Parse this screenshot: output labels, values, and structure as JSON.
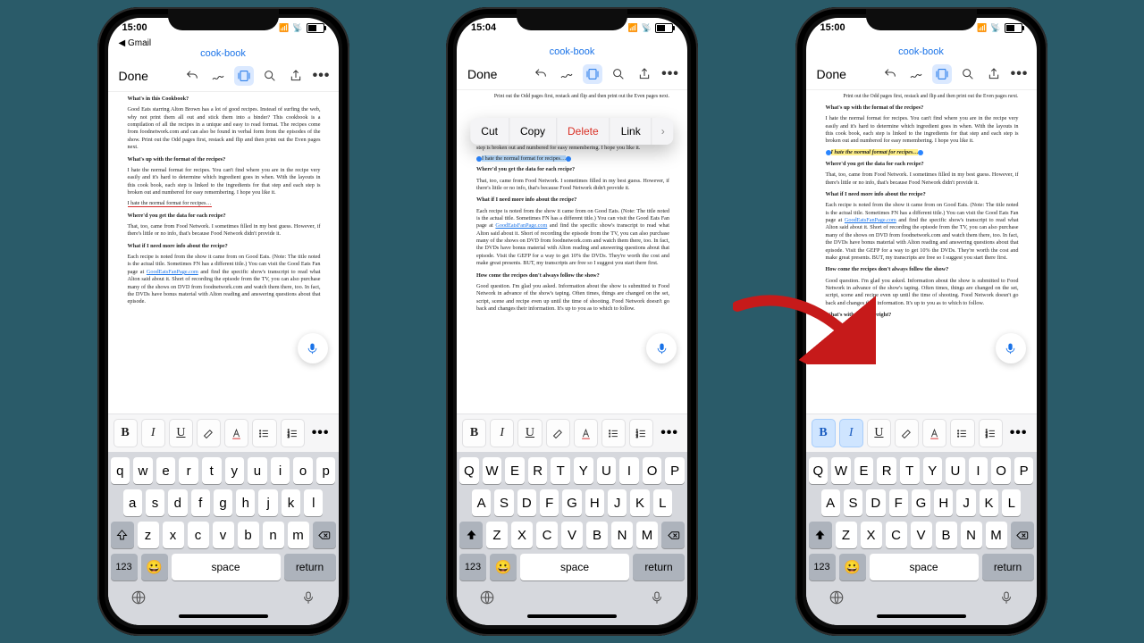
{
  "status": {
    "time1": "15:00",
    "time2": "15:04",
    "time3": "15:00"
  },
  "back_label": "◀ Gmail",
  "doc_title": "cook-book",
  "toolbar": {
    "done": "Done"
  },
  "context_menu": {
    "cut": "Cut",
    "copy": "Copy",
    "delete": "Delete",
    "link": "Link",
    "more": "›"
  },
  "format": {
    "bold": "B",
    "italic": "I",
    "underline": "U",
    "more": "•••"
  },
  "keyboard": {
    "row1_low": [
      "q",
      "w",
      "e",
      "r",
      "t",
      "y",
      "u",
      "i",
      "o",
      "p"
    ],
    "row1_up": [
      "Q",
      "W",
      "E",
      "R",
      "T",
      "Y",
      "U",
      "I",
      "O",
      "P"
    ],
    "row2_low": [
      "a",
      "s",
      "d",
      "f",
      "g",
      "h",
      "j",
      "k",
      "l"
    ],
    "row2_up": [
      "A",
      "S",
      "D",
      "F",
      "G",
      "H",
      "J",
      "K",
      "L"
    ],
    "row3_low": [
      "z",
      "x",
      "c",
      "v",
      "b",
      "n",
      "m"
    ],
    "row3_up": [
      "Z",
      "X",
      "C",
      "V",
      "B",
      "N",
      "M"
    ],
    "nums": "123",
    "space": "space",
    "ret": "return",
    "emoji": "😀"
  },
  "doc_full": {
    "h1": "What's in this Cookbook?",
    "p1": "Good Eats starring Alton Brown has a lot of good recipes. Instead of surfing the web, why not print them all out and stick them into a binder? This cookbook is a compilation of all the recipes in a unique and easy to read format. The recipes come from foodnetwork.com and can also be found in verbal form from the episodes of the show. Print out the Odd pages first, restack and flip and then print out the Even pages next.",
    "h2": "What's up with the format of the recipes?",
    "p2": "I hate the normal format for recipes. You can't find where you are in the recipe very easily and it's hard to determine which ingredient goes in when. With the layouts in this cook book, each step is linked to the ingredients for that step and each step is broken out and numbered for easy remembering. I hope you like it.",
    "p2_last": "I hate the normal format for recipes…",
    "h3": "Where'd you get the data for each recipe?",
    "p3": "That, too, came from Food Network. I sometimes filled in my best guess. However, if there's little or no info, that's because Food Network didn't provide it.",
    "h4": "What if I need more info about the recipe?",
    "p4a": "Each recipe is noted from the show it came from on Good Eats. (Note: The title noted is the actual title. Sometimes FN has a different title.) You can visit the Good Eats Fan page at ",
    "link1": "GoodEatsFanPage.com",
    "p4b": " and find the specific show's transcript to read what Alton said about it. Short of recording the episode from the TV, you can also purchase many of the shows on DVD from foodnetwork.com and watch them there, too. In fact, the DVDs have bonus material with Alton reading and answering questions about that episode."
  },
  "doc_partial": {
    "top": "Print out the Odd pages first, restack and flip and then print out the Even pages next.",
    "p2a": "cipe very easily and it's hard to determine which ingredient goes in when. With the layouts in this cook book, each step is linked to the ingredients for that step and each step is broken out and numbered for easy remembering. I hope you like it.",
    "sel": "I hate the normal format for recipes…",
    "h3": "Where'd you get the data for each recipe?",
    "p3": "That, too, came from Food Network. I sometimes filled in my best guess. However, if there's little or no info, that's because Food Network didn't provide it.",
    "h4": "What if I need more info about the recipe?",
    "p4a": "Each recipe is noted from the show it came from on Good Eats. (Note: The title noted is the actual title. Sometimes FN has a different title.) You can visit the Good Eats Fan page at ",
    "link1": "GoodEatsFanPage.com",
    "p4b": " and find the specific show's transcript to read what Alton said about it. Short of recording the episode from the TV, you can also purchase many of the shows on DVD from foodnetwork.com and watch them there, too. In fact, the DVDs have bonus material with Alton reading and answering questions about that episode. Visit the GEFP for a way to get 10% the DVDs. They're worth the cost and make great presents. BUT, my transcripts are free so I suggest you start there first.",
    "h5": "How come the recipes don't always follow the show?",
    "p5": "Good question. I'm glad you asked. Information about the show is submitted to Food Network in advance of the show's taping. Often times, things are changed on the set, script, scene and recipe even up until the time of shooting. Food Network doesn't go back and changes their information. It's up to you as to which to follow.",
    "h6": "What's with the Copyright?"
  },
  "doc_hl": {
    "h2": "What's up with the format of the recipes?",
    "p2": "I hate the normal format for recipes. You can't find where you are in the recipe very easily and it's hard to determine which ingredient goes in when. With the layouts in this cook book, each step is linked to the ingredients for that step and each step is broken out and numbered for easy remembering. I hope you like it.",
    "sel": "I hate the normal format for recipes…"
  }
}
